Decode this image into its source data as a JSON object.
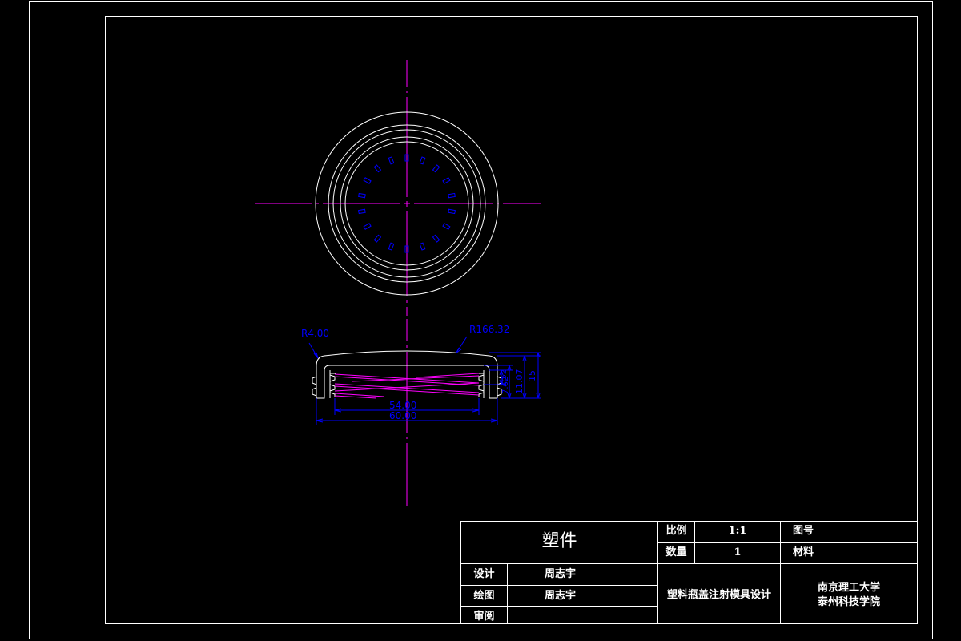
{
  "colors": {
    "background": "#000000",
    "outline": "#ffffff",
    "centerline": "#ff00ff",
    "dimension": "#0000ff",
    "thread": "#ff00ff"
  },
  "dimensions": {
    "fillet_radius": "R4.00",
    "top_radius": "R166.32",
    "inner_diameter": "54.00",
    "outer_diameter": "60.00",
    "dim_a": "2.52",
    "dim_b": "7.62",
    "dim_c": "11.07",
    "dim_d": "15"
  },
  "title_block": {
    "part_name": "塑件",
    "scale_label": "比例",
    "scale_value": "1:1",
    "drawing_no_label": "图号",
    "drawing_no_value": "",
    "quantity_label": "数量",
    "quantity_value": "1",
    "material_label": "材料",
    "material_value": "",
    "design_label": "设计",
    "design_name": "周志宇",
    "draw_label": "绘图",
    "draw_name": "周志宇",
    "review_label": "审阅",
    "review_name": "",
    "project_title": "塑料瓶盖注射模具设计",
    "school_line1": "南京理工大学",
    "school_line2": "泰州科技学院"
  }
}
